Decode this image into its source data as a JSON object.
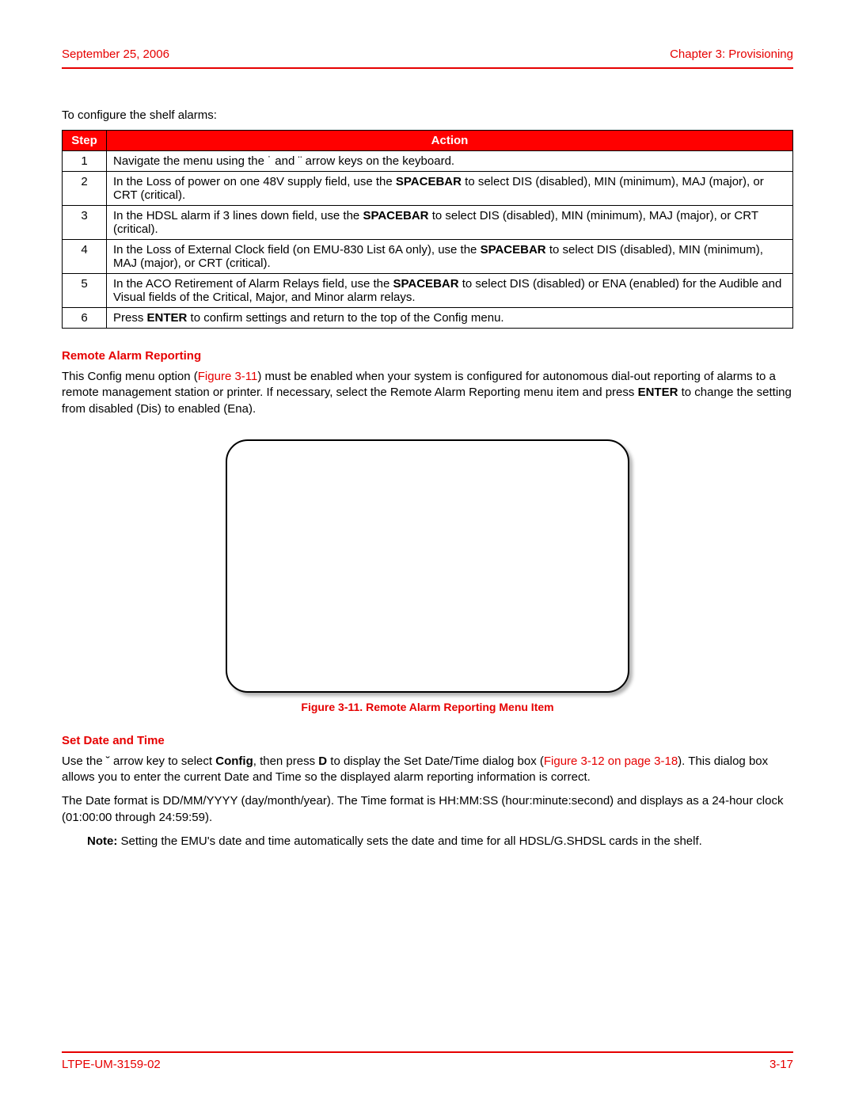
{
  "header": {
    "date": "September 25, 2006",
    "chapter": "Chapter 3: Provisioning"
  },
  "intro": "To configure the shelf alarms:",
  "table": {
    "headers": {
      "step": "Step",
      "action": "Action"
    },
    "rows": [
      {
        "num": "1",
        "segs": [
          {
            "t": "Navigate the menu using the  ˙  and  ¨  arrow keys on the keyboard."
          }
        ]
      },
      {
        "num": "2",
        "segs": [
          {
            "t": "In the Loss of power on one 48V supply field, use the "
          },
          {
            "t": "SPACEBAR",
            "b": true
          },
          {
            "t": " to select DIS (disabled), MIN (minimum), MAJ (major), or CRT (critical)."
          }
        ]
      },
      {
        "num": "3",
        "segs": [
          {
            "t": "In the HDSL alarm if 3 lines down field, use the "
          },
          {
            "t": "SPACEBAR",
            "b": true
          },
          {
            "t": " to select DIS (disabled), MIN (minimum), MAJ (major), or CRT (critical)."
          }
        ]
      },
      {
        "num": "4",
        "segs": [
          {
            "t": "In the Loss of External Clock field (on EMU-830 List 6A only), use the "
          },
          {
            "t": "SPACEBAR",
            "b": true
          },
          {
            "t": " to select DIS (disabled), MIN (minimum), MAJ (major), or CRT (critical)."
          }
        ]
      },
      {
        "num": "5",
        "segs": [
          {
            "t": "In the ACO Retirement of Alarm Relays field, use the "
          },
          {
            "t": "SPACEBAR",
            "b": true
          },
          {
            "t": " to select DIS (disabled) or ENA (enabled) for the Audible and Visual fields of the Critical, Major, and Minor alarm relays."
          }
        ]
      },
      {
        "num": "6",
        "segs": [
          {
            "t": "Press "
          },
          {
            "t": "ENTER",
            "b": true
          },
          {
            "t": " to confirm settings and return to the top of the Config menu."
          }
        ]
      }
    ]
  },
  "remote": {
    "title": "Remote Alarm Reporting",
    "para_segs": [
      {
        "t": "This Config menu option ("
      },
      {
        "t": "Figure 3-11",
        "ref": true
      },
      {
        "t": ") must be enabled when your system is configured for autonomous dial-out reporting of alarms to a remote management station or printer. If necessary, select the Remote Alarm Reporting menu item and press "
      },
      {
        "t": "ENTER",
        "b": true
      },
      {
        "t": " to change the setting from disabled (Dis) to enabled (Ena)."
      }
    ],
    "caption": "Figure 3-11. Remote Alarm Reporting Menu Item"
  },
  "setdate": {
    "title": "Set Date and Time",
    "p1_segs": [
      {
        "t": "Use the  ˘  arrow key to select "
      },
      {
        "t": "Config",
        "b": true
      },
      {
        "t": ", then press "
      },
      {
        "t": "D",
        "b": true
      },
      {
        "t": " to display the Set Date/Time dialog box ("
      },
      {
        "t": "Figure 3-12 on page 3-18",
        "ref": true
      },
      {
        "t": "). This dialog box allows you to enter the current Date and Time so the displayed alarm reporting information is correct."
      }
    ],
    "p2": "The Date format is DD/MM/YYYY (day/month/year). The Time format is HH:MM:SS (hour:minute:second) and displays as a 24-hour clock (01:00:00 through 24:59:59).",
    "note_segs": [
      {
        "t": "Note:",
        "b": true
      },
      {
        "t": " Setting the EMU's date and time automatically sets the date and time for all HDSL/G.SHDSL cards in the shelf."
      }
    ]
  },
  "footer": {
    "doc": "LTPE-UM-3159-02",
    "page": "3-17"
  }
}
